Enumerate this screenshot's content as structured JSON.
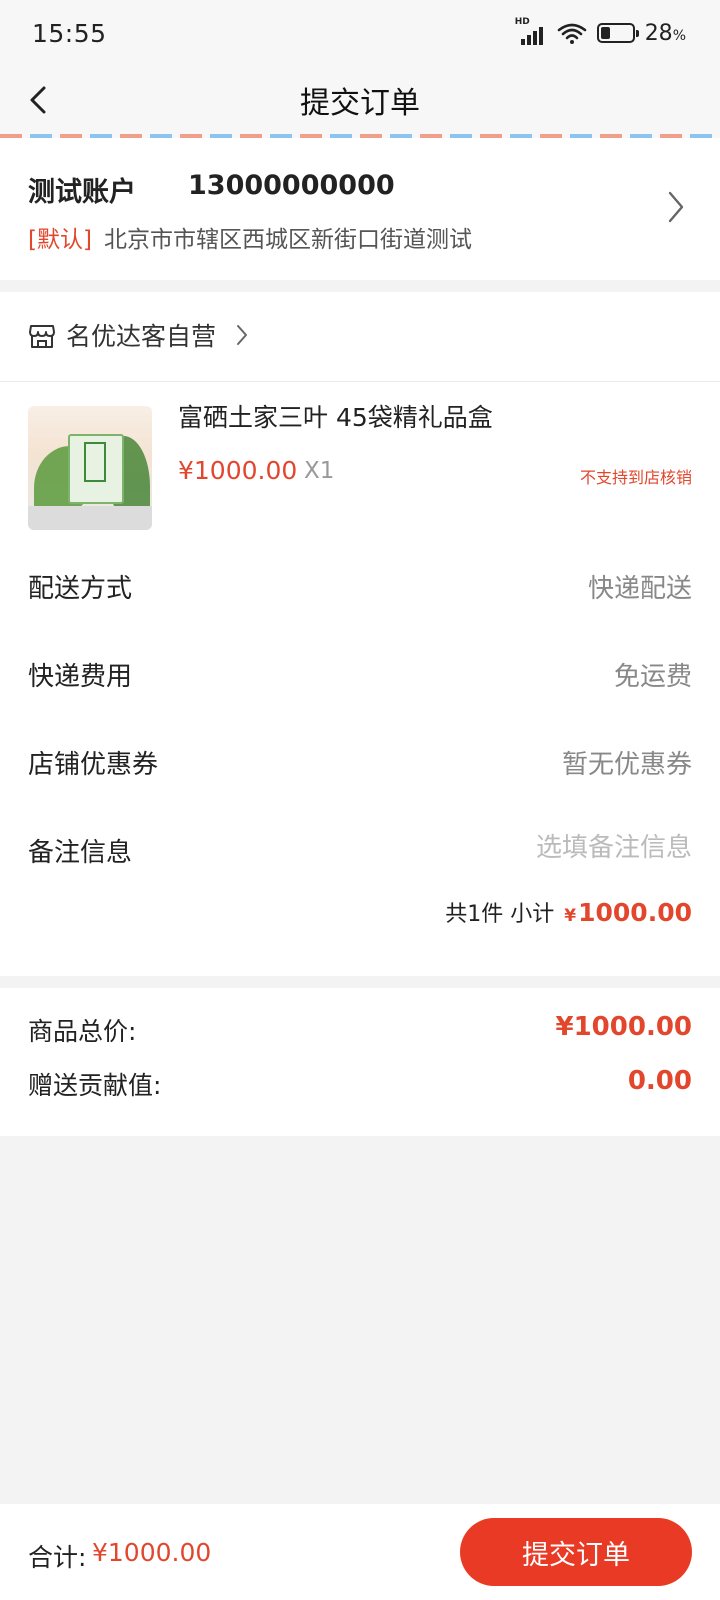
{
  "status_bar": {
    "time": "15:55",
    "network": "HD",
    "battery": "28",
    "battery_unit": "%"
  },
  "nav": {
    "title": "提交订单",
    "back_icon": "chevron-left-icon"
  },
  "address": {
    "name": "测试账户",
    "phone": "13000000000",
    "default_tag": "[默认]",
    "detail": "北京市市辖区西城区新街口街道测试"
  },
  "shop": {
    "name": "名优达客自营",
    "icon": "store-icon"
  },
  "product": {
    "name": "富硒土家三叶 45袋精礼品盒",
    "price": "¥1000.00",
    "quantity": "X1",
    "note": "不支持到店核销"
  },
  "options": {
    "delivery_label": "配送方式",
    "delivery_value": "快递配送",
    "shipping_label": "快递费用",
    "shipping_value": "免运费",
    "coupon_label": "店铺优惠券",
    "coupon_value": "暂无优惠券",
    "remark_label": "备注信息",
    "remark_placeholder": "选填备注信息",
    "remark_value": ""
  },
  "subtotal": {
    "count_text": "共1件 小计",
    "currency": "¥",
    "amount": "1000.00"
  },
  "totals": {
    "goods_label": "商品总价:",
    "goods_value": "¥1000.00",
    "contribution_label": "赠送贡献值:",
    "contribution_value": "0.00"
  },
  "footer": {
    "total_label": "合计:",
    "total_value": "¥1000.00",
    "submit_label": "提交订单"
  },
  "colors": {
    "accent_red": "#e93a25",
    "price_red": "#e2472e",
    "background": "#f3f3f3"
  }
}
